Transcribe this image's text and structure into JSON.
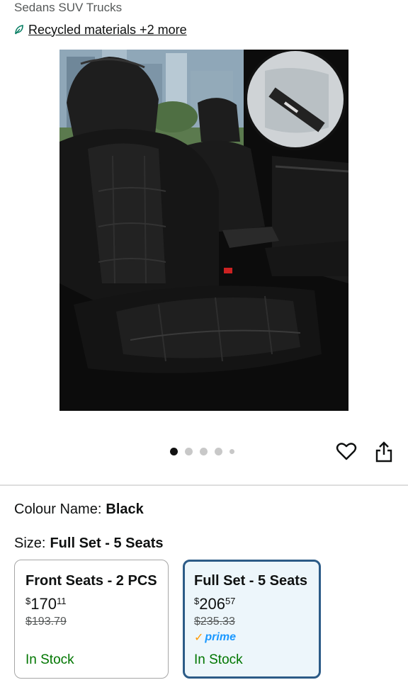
{
  "header": {
    "vehicle_types": "Sedans SUV Trucks",
    "sustainability_link": "Recycled materials +2 more"
  },
  "gallery": {
    "image_icon": "car-seat-cover-product-photo",
    "dots": [
      {
        "active": true
      },
      {
        "active": false
      },
      {
        "active": false
      },
      {
        "active": false
      },
      {
        "active": false,
        "small": true
      }
    ],
    "wishlist_icon": "heart-icon",
    "share_icon": "share-icon"
  },
  "colour": {
    "label": "Colour Name:",
    "value": "Black"
  },
  "size": {
    "label": "Size:",
    "value": "Full Set - 5 Seats",
    "options": [
      {
        "title": "Front Seats - 2 PCS",
        "price_symbol": "$",
        "price_whole": "170",
        "price_fraction": "11",
        "list_price": "$193.79",
        "availability": "In Stock",
        "selected": false
      },
      {
        "title": "Full Set - 5 Seats",
        "price_symbol": "$",
        "price_whole": "206",
        "price_fraction": "57",
        "list_price": "$235.33",
        "prime_label": "prime",
        "availability": "In Stock",
        "selected": true
      }
    ]
  },
  "colors": {
    "selected_border": "#2c5b87",
    "selected_bg": "#edf6fb",
    "in_stock": "#007600",
    "prime_blue": "#1a98ff",
    "prime_check": "#ff9900"
  }
}
